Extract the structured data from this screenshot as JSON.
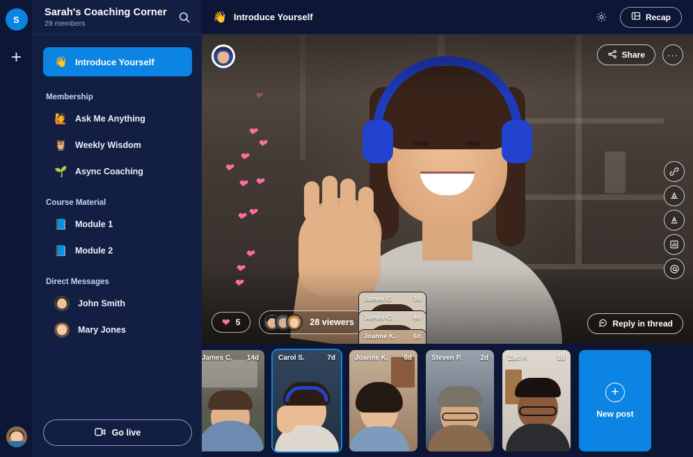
{
  "workspace": {
    "avatar_initial": "S",
    "add_label": "+",
    "accent": "#0b84e3",
    "sidebar_bg": "#131f42",
    "rail_bg": "#0d1634"
  },
  "sidebar": {
    "title": "Sarah's Coaching Corner",
    "members": "29 members",
    "search_icon": "search-icon",
    "active_item": {
      "emoji": "👋",
      "label": "Introduce Yourself"
    },
    "groups": [
      {
        "title": "Membership",
        "items": [
          {
            "emoji": "🙋",
            "label": "Ask Me Anything"
          },
          {
            "emoji": "🦉",
            "label": "Weekly Wisdom"
          },
          {
            "emoji": "🌱",
            "label": "Async Coaching"
          }
        ]
      },
      {
        "title": "Course Material",
        "items": [
          {
            "emoji": "📘",
            "label": "Module 1"
          },
          {
            "emoji": "📘",
            "label": "Module 2"
          }
        ]
      },
      {
        "title": "Direct Messages",
        "items": [
          {
            "avatar": "dm1",
            "label": "John Smith"
          },
          {
            "avatar": "dm2",
            "label": "Mary Jones"
          }
        ]
      }
    ],
    "go_live_label": "Go live",
    "go_live_icon": "video-camera-icon"
  },
  "topbar": {
    "emoji": "👋",
    "title": "Introduce Yourself",
    "settings_icon": "gear-icon",
    "recap_label": "Recap",
    "recap_icon": "grid-icon"
  },
  "stage": {
    "avatar_name": "stage-author-avatar",
    "share_label": "Share",
    "share_icon": "share-icon",
    "more_label": "···",
    "reaction_count": "5",
    "reaction_icon": "heart-icon",
    "viewers_label": "28 viewers",
    "reply_label": "Reply in thread",
    "reply_icon": "comment-icon",
    "tools": [
      {
        "name": "link-icon",
        "glyph": "🔗"
      },
      {
        "name": "sticker-icon",
        "glyph": "✪"
      },
      {
        "name": "text-icon",
        "glyph": "A"
      },
      {
        "name": "poll-icon",
        "glyph": "📊"
      },
      {
        "name": "mention-icon",
        "glyph": "@"
      }
    ],
    "floating_cards": [
      {
        "name": "James C.",
        "time": "3d",
        "skin": "#dcb189",
        "hair": "#3b2a1d",
        "bg": "#cfc4b3"
      },
      {
        "name": "James C.",
        "time": "4d",
        "skin": "#dcb189",
        "hair": "#3b2a1d",
        "bg": "#cfc4b3"
      },
      {
        "name": "Joanne K.",
        "time": "6d",
        "skin": "#e5bb95",
        "hair": "#241a14",
        "bg": "#b59478"
      }
    ]
  },
  "filmstrip": {
    "cards": [
      {
        "name": "James C.",
        "time": "14d",
        "selected": false,
        "skin": "#e0b088",
        "hair": "#4a3425",
        "shirt": "#6d8ab0",
        "bg": "#6d6a60"
      },
      {
        "name": "Carol S.",
        "time": "7d",
        "selected": true,
        "skin": "#e8bb93",
        "hair": "#2c1d14",
        "shirt": "#ded7cd",
        "bg": "#2a3a4e"
      },
      {
        "name": "Joanne K.",
        "time": "6d",
        "selected": false,
        "skin": "#e5bb95",
        "hair": "#241a14",
        "shirt": "#7e9bbd",
        "bg": "#b09277"
      },
      {
        "name": "Steven P.",
        "time": "2d",
        "selected": false,
        "skin": "#d8a87e",
        "hair": "#7a7368",
        "shirt": "#8a6a4e",
        "bg": "#7f8894"
      },
      {
        "name": "Zac P.",
        "time": "1d",
        "selected": false,
        "skin": "#8a5a3a",
        "hair": "#1a1210",
        "shirt": "#2c2c30",
        "bg": "#cfc9c0"
      }
    ],
    "new_post_label": "New post",
    "new_post_icon": "plus-circle-icon"
  }
}
